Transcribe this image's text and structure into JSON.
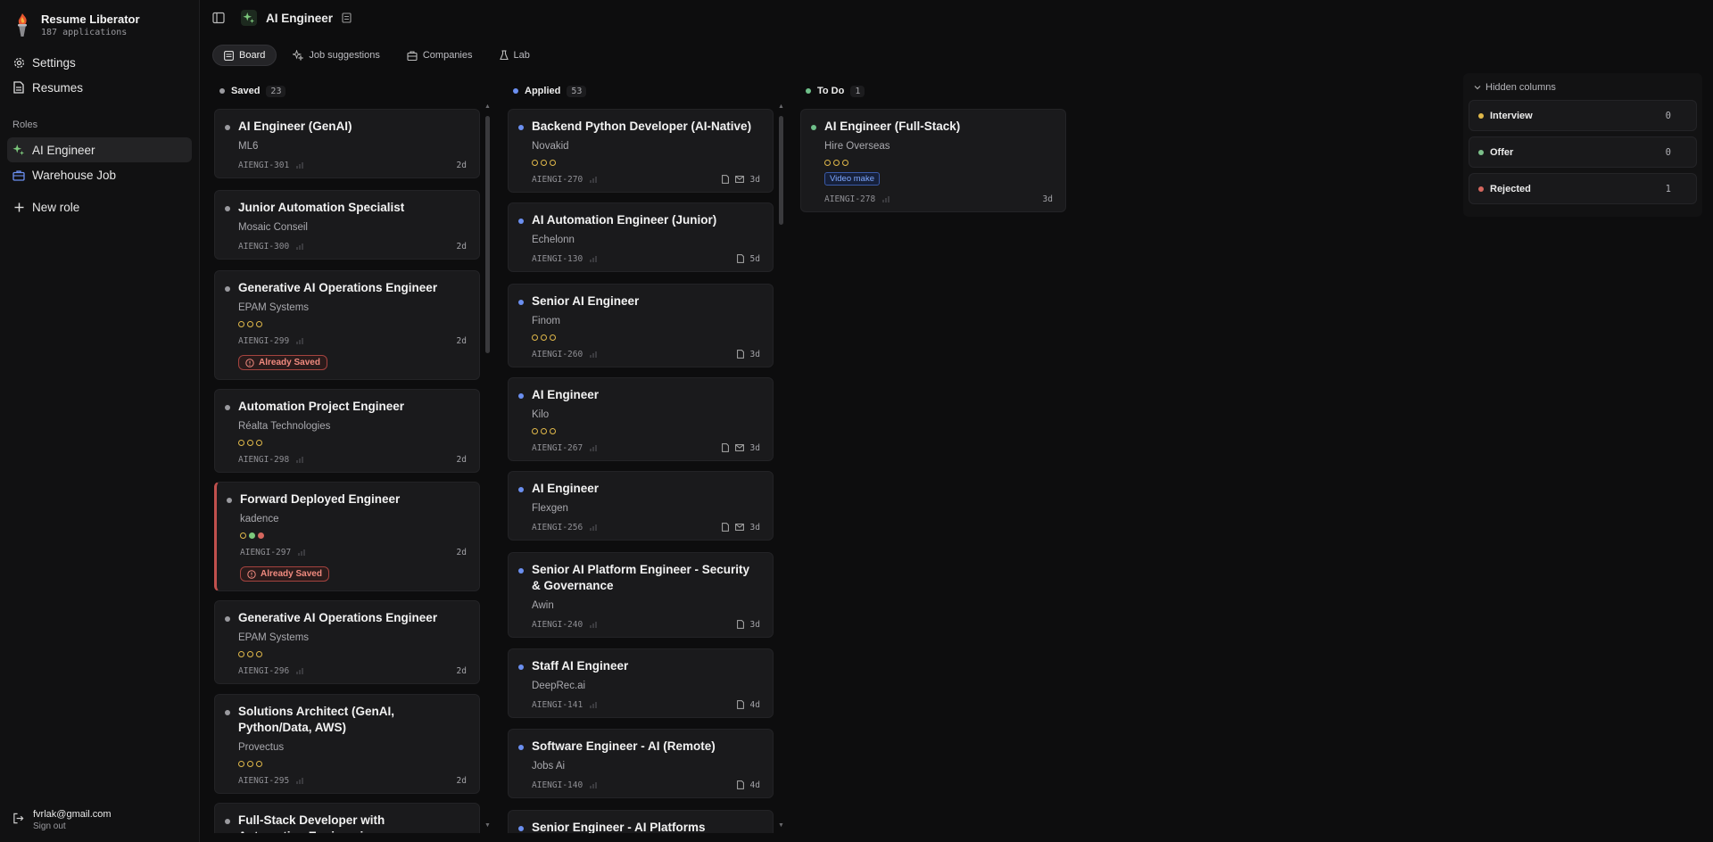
{
  "app": {
    "name": "Resume Liberator",
    "subtitle": "187 applications"
  },
  "sidebar": {
    "nav": [
      {
        "label": "Settings",
        "icon": "gear-icon"
      },
      {
        "label": "Resumes",
        "icon": "document-icon"
      }
    ],
    "roles_label": "Roles",
    "roles": [
      {
        "label": "AI Engineer",
        "icon": "sparkles-icon",
        "active": true
      },
      {
        "label": "Warehouse Job",
        "icon": "briefcase-icon",
        "active": false
      }
    ],
    "new_role_label": "New role",
    "user": {
      "email": "fvrlak@gmail.com",
      "sign_out": "Sign out"
    }
  },
  "header": {
    "title": "AI Engineer"
  },
  "tabs": [
    {
      "label": "Board",
      "icon": "board-icon",
      "active": true
    },
    {
      "label": "Job suggestions",
      "icon": "sparkles-icon",
      "active": false
    },
    {
      "label": "Companies",
      "icon": "building-icon",
      "active": false
    },
    {
      "label": "Lab",
      "icon": "flask-icon",
      "active": false
    }
  ],
  "colors": {
    "saved": "#9a9a9f",
    "applied": "#6b8ff0",
    "todo": "#6fc08a",
    "interview": "#e0b84a",
    "offer": "#7cc08a",
    "rejected": "#d5675e",
    "flag": "#c0504d"
  },
  "columns": {
    "saved": {
      "label": "Saved",
      "count": "23",
      "cards": [
        {
          "title": "AI Engineer (GenAI)",
          "company": "ML6",
          "id": "AIENGI-301",
          "age": "2d"
        },
        {
          "title": "Junior Automation Specialist",
          "company": "Mosaic Conseil",
          "id": "AIENGI-300",
          "age": "2d"
        },
        {
          "title": "Generative AI Operations Engineer",
          "company": "EPAM Systems",
          "id": "AIENGI-299",
          "age": "2d",
          "warning": "Already Saved"
        },
        {
          "title": "Automation Project Engineer",
          "company": "Réalta Technologies",
          "id": "AIENGI-298",
          "age": "2d"
        },
        {
          "title": "Forward Deployed Engineer",
          "company": "kadence",
          "id": "AIENGI-297",
          "age": "2d",
          "warning": "Already Saved"
        },
        {
          "title": "Generative AI Operations Engineer",
          "company": "EPAM Systems",
          "id": "AIENGI-296",
          "age": "2d"
        },
        {
          "title": "Solutions Architect (GenAI, Python/Data, AWS)",
          "company": "Provectus",
          "id": "AIENGI-295",
          "age": "2d"
        },
        {
          "title": "Full-Stack Developer with Automation Engineering",
          "company": "",
          "id": "",
          "age": ""
        }
      ]
    },
    "applied": {
      "label": "Applied",
      "count": "53",
      "cards": [
        {
          "title": "Backend Python Developer (AI-Native)",
          "company": "Novakid",
          "id": "AIENGI-270",
          "age": "3d"
        },
        {
          "title": "AI Automation Engineer (Junior)",
          "company": "Echelonn",
          "id": "AIENGI-130",
          "age": "5d"
        },
        {
          "title": "Senior AI Engineer",
          "company": "Finom",
          "id": "AIENGI-260",
          "age": "3d"
        },
        {
          "title": "AI Engineer",
          "company": "Kilo",
          "id": "AIENGI-267",
          "age": "3d"
        },
        {
          "title": "AI Engineer",
          "company": "Flexgen",
          "id": "AIENGI-256",
          "age": "3d"
        },
        {
          "title": "Senior AI Platform Engineer - Security & Governance",
          "company": "Awin",
          "id": "AIENGI-240",
          "age": "3d"
        },
        {
          "title": "Staff AI Engineer",
          "company": "DeepRec.ai",
          "id": "AIENGI-141",
          "age": "4d"
        },
        {
          "title": "Software Engineer - AI (Remote)",
          "company": "Jobs Ai",
          "id": "AIENGI-140",
          "age": "4d"
        },
        {
          "title": "Senior Engineer - AI Platforms",
          "company": "",
          "id": "",
          "age": ""
        }
      ]
    },
    "todo": {
      "label": "To Do",
      "count": "1",
      "cards": [
        {
          "title": "AI Engineer (Full-Stack)",
          "company": "Hire Overseas",
          "id": "AIENGI-278",
          "age": "3d",
          "tag": "Video make"
        }
      ]
    }
  },
  "hidden_columns": {
    "label": "Hidden columns",
    "items": [
      {
        "label": "Interview",
        "count": "0"
      },
      {
        "label": "Offer",
        "count": "0"
      },
      {
        "label": "Rejected",
        "count": "1"
      }
    ]
  }
}
